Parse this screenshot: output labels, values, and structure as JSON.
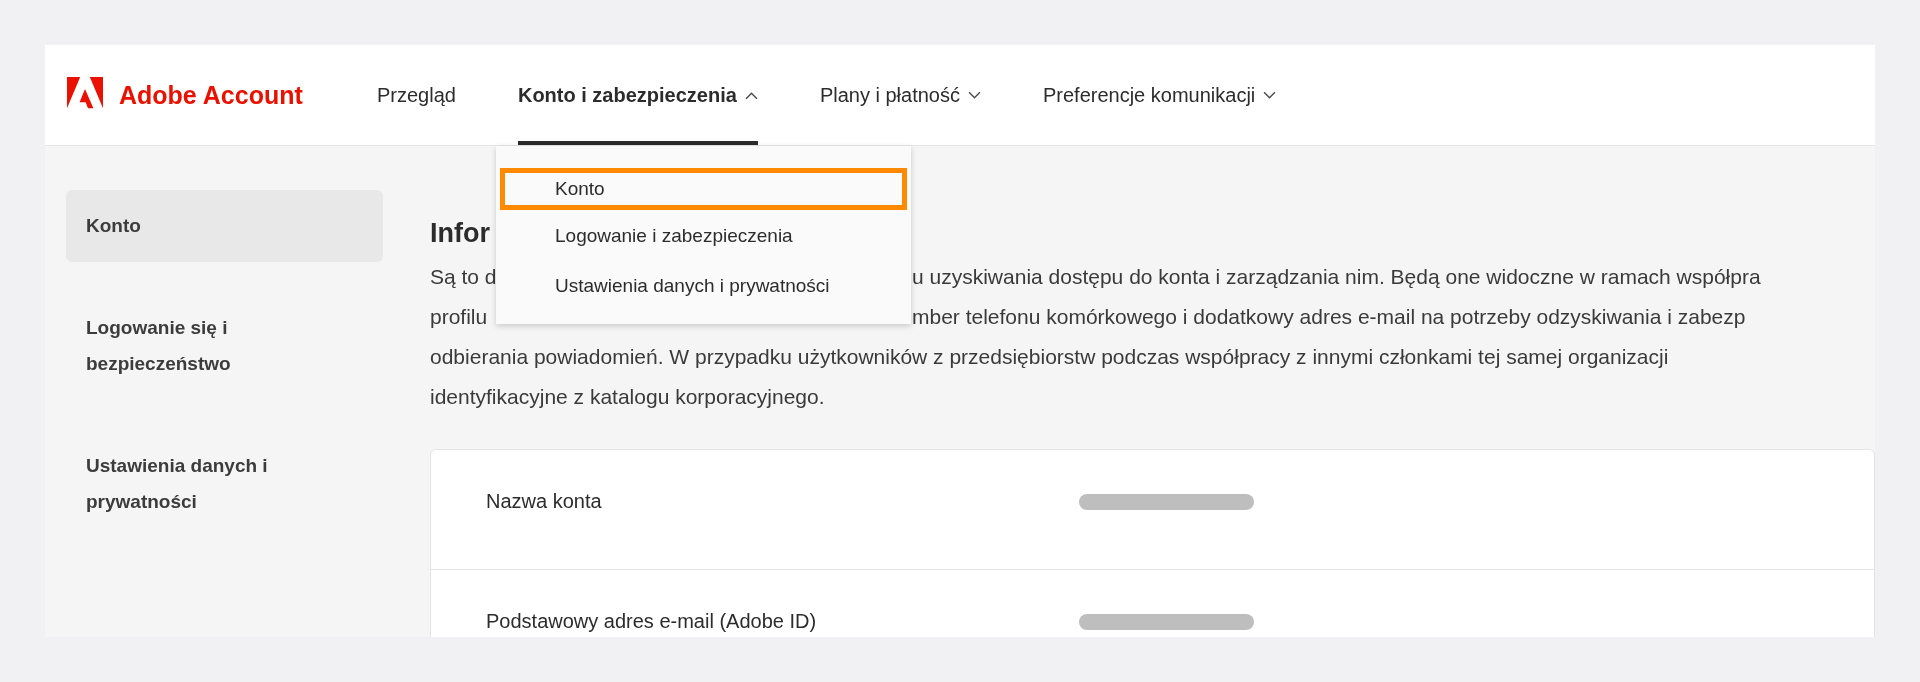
{
  "brand": {
    "name": "Adobe Account"
  },
  "nav": [
    {
      "label": "Przegląd",
      "selected": false
    },
    {
      "label": "Konto i zabezpieczenia",
      "selected": true,
      "expanded": true
    },
    {
      "label": "Plany i płatność",
      "selected": false,
      "expanded": false
    },
    {
      "label": "Preferencje komunikacji",
      "selected": false,
      "expanded": false
    }
  ],
  "dropdown": {
    "items": [
      {
        "label": "Konto",
        "focused": true
      },
      {
        "label": "Logowanie i zabezpieczenia",
        "focused": false
      },
      {
        "label": "Ustawienia danych i prywatności",
        "focused": false
      }
    ]
  },
  "sidebar": {
    "items": [
      {
        "label": "Konto",
        "selected": true
      },
      {
        "label": "Logowanie się i bezpieczeństwo",
        "selected": false
      },
      {
        "label": "Ustawienia danych i prywatności",
        "selected": false
      }
    ]
  },
  "section": {
    "heading": "Infor",
    "lines": [
      {
        "left": "Są to d",
        "right": "u uzyskiwania dostępu do konta i zarządzania nim. Będą one widoczne w ramach współpra"
      },
      {
        "left": "profilu",
        "right": "mber telefonu komórkowego i dodatkowy adres e-mail na potrzeby odzyskiwania i zabezp"
      },
      {
        "left": "odbierania powiadomień. W przypadku użytkowników z przedsiębiorstw podczas współpracy z innymi członkami tej samej organizacji"
      },
      {
        "left": "identyfikacyjne z katalogu korporacyjnego."
      }
    ]
  },
  "card": {
    "rows": [
      {
        "label": "Nazwa konta",
        "redacted": true
      },
      {
        "label": "Podstawowy adres e-mail (Adobe ID)",
        "redacted": true
      }
    ]
  }
}
